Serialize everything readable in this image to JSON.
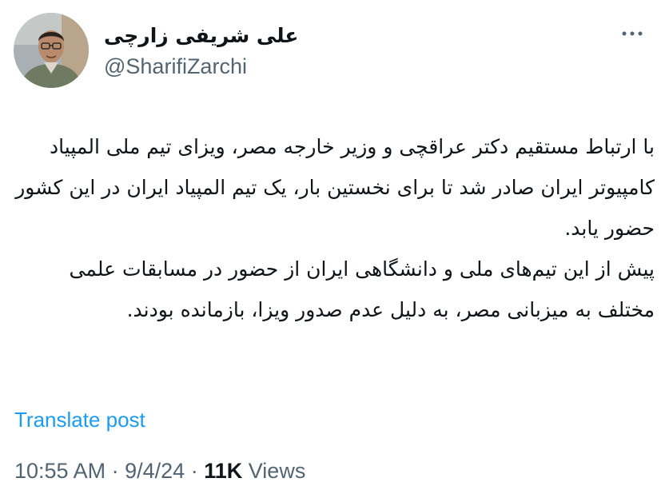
{
  "author": {
    "name": "علی شریفی زارچی",
    "handle": "@SharifiZarchi",
    "avatar_icon": "profile-photo"
  },
  "menu": {
    "more_icon": "more-options-icon"
  },
  "post": {
    "paragraphs": [
      "با ارتباط مستقیم دکتر عراقچی و وزیر خارجه مصر، ویزای تیم ملی المپیاد کامپیوتر ایران صادر شد تا برای نخستین بار، یک تیم المپیاد ایران در این کشور حضور یابد.",
      "پیش از این تیم‌های ملی و دانشگاهی ایران از حضور در مسابقات علمی مختلف به میزبانی مصر، به دلیل عدم صدور ویزا، بازمانده بودند."
    ],
    "translate_label": "Translate post"
  },
  "meta": {
    "time": "10:55 AM",
    "separator": "·",
    "date": "9/4/24",
    "views_count": "11K",
    "views_label": "Views"
  },
  "colors": {
    "text": "#0f1419",
    "secondary": "#536471",
    "link": "#1d9bf0"
  }
}
